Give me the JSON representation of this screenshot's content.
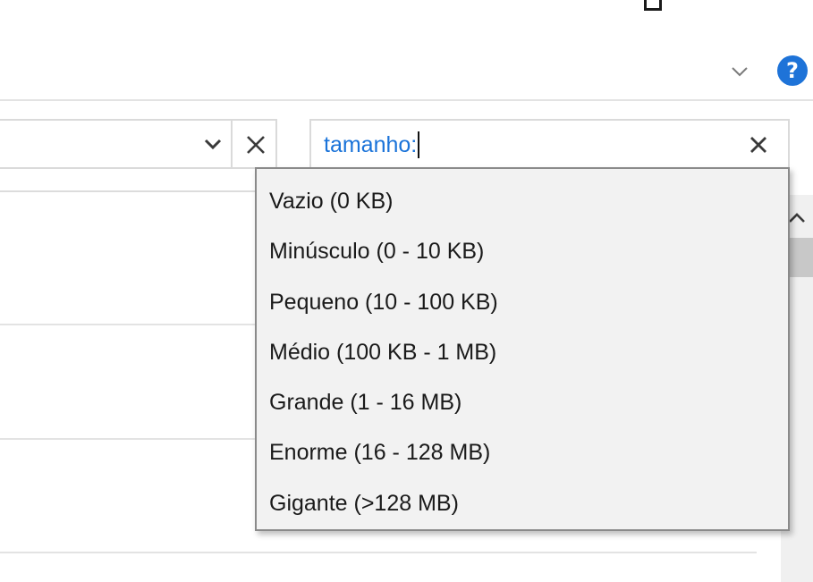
{
  "window": {
    "maximize_icon": "maximize-icon",
    "close_icon": "close-icon"
  },
  "ribbon": {
    "expand_icon": "chevron-down-icon",
    "help_label": "?",
    "help_color": "#1e73d8"
  },
  "address_bar": {
    "dropdown_icon": "chevron-down-icon",
    "clear_icon": "close-icon"
  },
  "search": {
    "value": "tamanho:",
    "value_color": "#1a73d9",
    "clear_icon": "close-icon"
  },
  "size_filter_menu": {
    "items": [
      {
        "label": "Vazio (0 KB)"
      },
      {
        "label": "Minúsculo (0 - 10 KB)"
      },
      {
        "label": "Pequeno (10 - 100 KB)"
      },
      {
        "label": "Médio (100 KB - 1 MB)"
      },
      {
        "label": "Grande (1 - 16 MB)"
      },
      {
        "label": "Enorme (16 - 128 MB)"
      },
      {
        "label": "Gigante (>128 MB)"
      }
    ]
  },
  "scrollbar": {
    "up_icon": "chevron-up-icon"
  }
}
